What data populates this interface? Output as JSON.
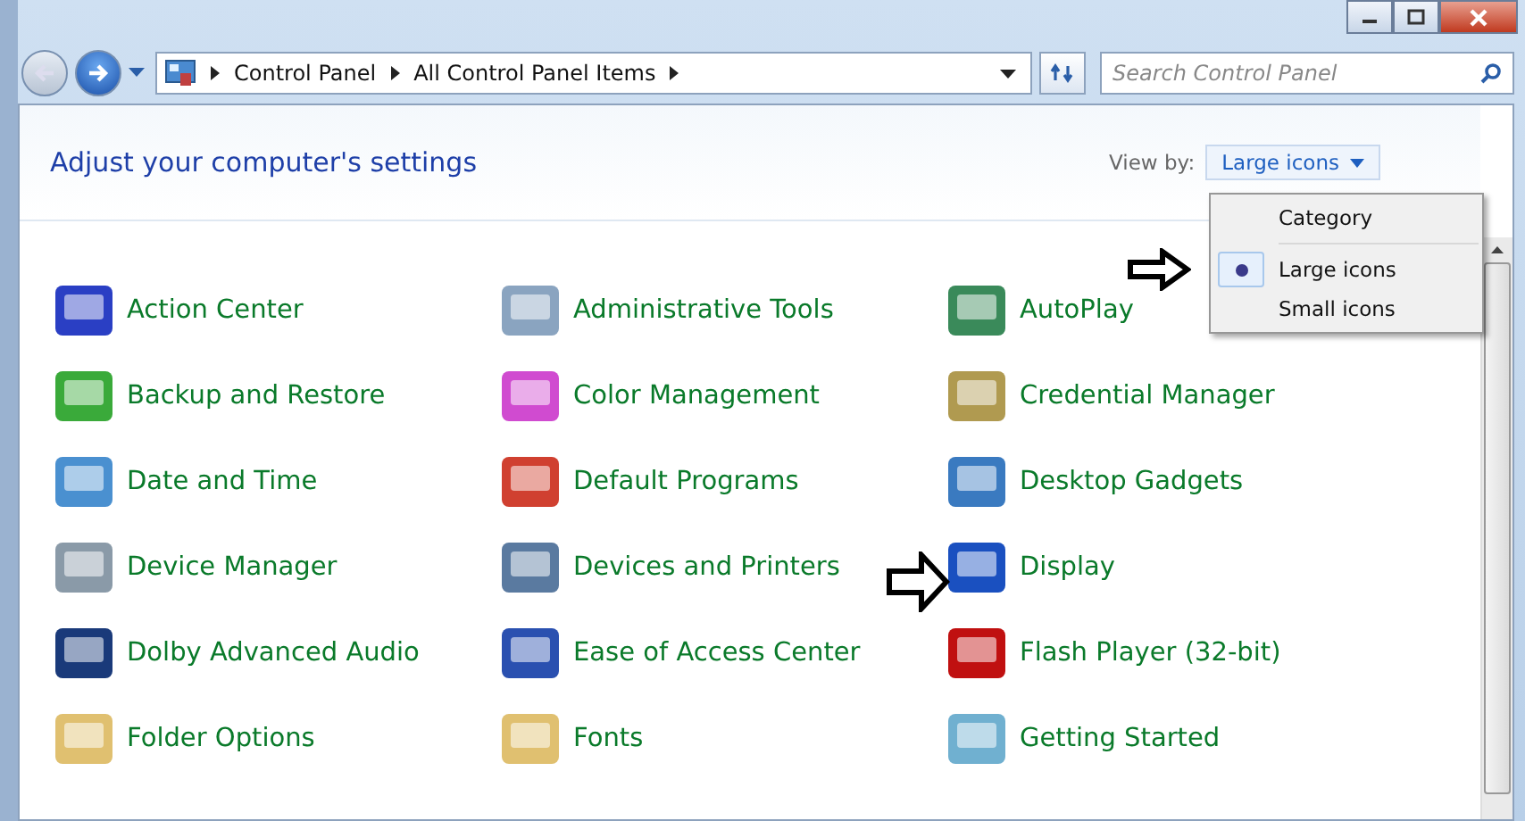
{
  "address_bar": {
    "breadcrumbs": [
      "Control Panel",
      "All Control Panel Items"
    ]
  },
  "search": {
    "placeholder": "Search Control Panel"
  },
  "header": {
    "title": "Adjust your computer's settings",
    "view_by_label": "View by:",
    "view_by_value": "Large icons"
  },
  "view_menu": {
    "items": [
      {
        "label": "Category",
        "selected": false
      },
      {
        "label": "Large icons",
        "selected": true
      },
      {
        "label": "Small icons",
        "selected": false
      }
    ]
  },
  "items": [
    {
      "label": "Action Center"
    },
    {
      "label": "Administrative Tools"
    },
    {
      "label": "AutoPlay"
    },
    {
      "label": "Backup and Restore"
    },
    {
      "label": "Color Management"
    },
    {
      "label": "Credential Manager"
    },
    {
      "label": "Date and Time"
    },
    {
      "label": "Default Programs"
    },
    {
      "label": "Desktop Gadgets"
    },
    {
      "label": "Device Manager"
    },
    {
      "label": "Devices and Printers"
    },
    {
      "label": "Display"
    },
    {
      "label": "Dolby Advanced Audio"
    },
    {
      "label": "Ease of Access Center"
    },
    {
      "label": "Flash Player (32-bit)"
    },
    {
      "label": "Folder Options"
    },
    {
      "label": "Fonts"
    },
    {
      "label": "Getting Started"
    }
  ]
}
